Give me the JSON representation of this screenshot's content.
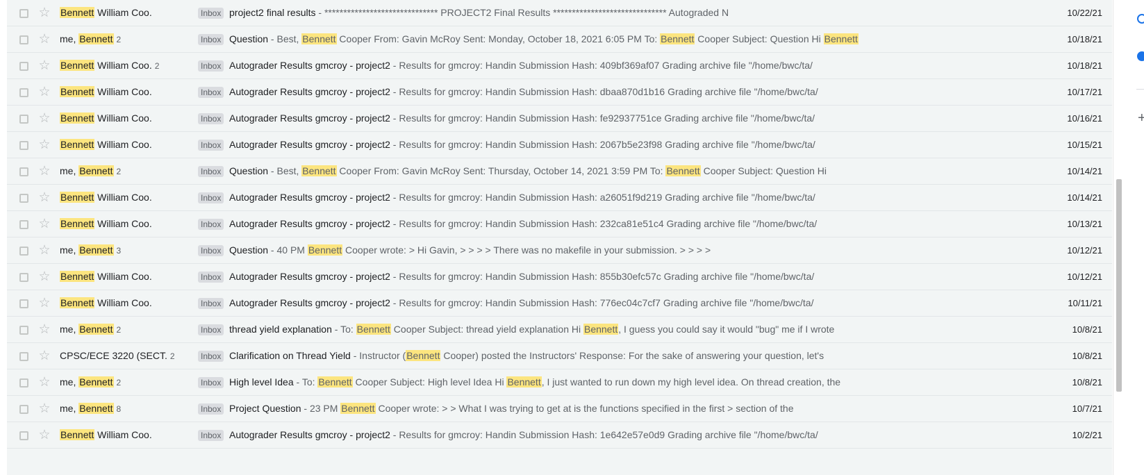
{
  "mail": {
    "label": "Inbox",
    "rows": [
      {
        "sender": [
          {
            "t": "Bennett",
            "h": true
          },
          {
            "t": " William Coo.",
            "h": false
          }
        ],
        "count": "",
        "subject": "project2 final results",
        "snippet": [
          {
            "t": " - ****************************** PROJECT2 Final Results ****************************** Autograded N",
            "h": false
          }
        ],
        "date": "10/22/21"
      },
      {
        "sender": [
          {
            "t": "me, ",
            "h": false
          },
          {
            "t": "Bennett",
            "h": true
          }
        ],
        "count": "2",
        "subject": "Question",
        "snippet": [
          {
            "t": " - Best, ",
            "h": false
          },
          {
            "t": "Bennett",
            "h": true
          },
          {
            "t": " Cooper From: Gavin McRoy Sent: Monday, October 18, 2021 6:05 PM To: ",
            "h": false
          },
          {
            "t": "Bennett",
            "h": true
          },
          {
            "t": " Cooper Subject: Question Hi ",
            "h": false
          },
          {
            "t": "Bennett",
            "h": true
          }
        ],
        "date": "10/18/21"
      },
      {
        "sender": [
          {
            "t": "Bennett",
            "h": true
          },
          {
            "t": " William Coo.",
            "h": false
          }
        ],
        "count": "2",
        "subject": "Autograder Results gmcroy - project2",
        "snippet": [
          {
            "t": " - Results for gmcroy: Handin Submission Hash: 409bf369af07 Grading archive file \"/home/bwc/ta/",
            "h": false
          }
        ],
        "date": "10/18/21"
      },
      {
        "sender": [
          {
            "t": "Bennett",
            "h": true
          },
          {
            "t": " William Coo.",
            "h": false
          }
        ],
        "count": "",
        "subject": "Autograder Results gmcroy - project2",
        "snippet": [
          {
            "t": " - Results for gmcroy: Handin Submission Hash: dbaa870d1b16 Grading archive file \"/home/bwc/ta/",
            "h": false
          }
        ],
        "date": "10/17/21"
      },
      {
        "sender": [
          {
            "t": "Bennett",
            "h": true
          },
          {
            "t": " William Coo.",
            "h": false
          }
        ],
        "count": "",
        "subject": "Autograder Results gmcroy - project2",
        "snippet": [
          {
            "t": " - Results for gmcroy: Handin Submission Hash: fe92937751ce Grading archive file \"/home/bwc/ta/",
            "h": false
          }
        ],
        "date": "10/16/21"
      },
      {
        "sender": [
          {
            "t": "Bennett",
            "h": true
          },
          {
            "t": " William Coo.",
            "h": false
          }
        ],
        "count": "",
        "subject": "Autograder Results gmcroy - project2",
        "snippet": [
          {
            "t": " - Results for gmcroy: Handin Submission Hash: 2067b5e23f98 Grading archive file \"/home/bwc/ta/",
            "h": false
          }
        ],
        "date": "10/15/21"
      },
      {
        "sender": [
          {
            "t": "me, ",
            "h": false
          },
          {
            "t": "Bennett",
            "h": true
          }
        ],
        "count": "2",
        "subject": "Question",
        "snippet": [
          {
            "t": " - Best, ",
            "h": false
          },
          {
            "t": "Bennett",
            "h": true
          },
          {
            "t": " Cooper From: Gavin McRoy Sent: Thursday, October 14, 2021 3:59 PM To: ",
            "h": false
          },
          {
            "t": "Bennett",
            "h": true
          },
          {
            "t": " Cooper Subject: Question Hi",
            "h": false
          }
        ],
        "date": "10/14/21"
      },
      {
        "sender": [
          {
            "t": "Bennett",
            "h": true
          },
          {
            "t": " William Coo.",
            "h": false
          }
        ],
        "count": "",
        "subject": "Autograder Results gmcroy - project2",
        "snippet": [
          {
            "t": " - Results for gmcroy: Handin Submission Hash: a26051f9d219 Grading archive file \"/home/bwc/ta/",
            "h": false
          }
        ],
        "date": "10/14/21"
      },
      {
        "sender": [
          {
            "t": "Bennett",
            "h": true
          },
          {
            "t": " William Coo.",
            "h": false
          }
        ],
        "count": "",
        "subject": "Autograder Results gmcroy - project2",
        "snippet": [
          {
            "t": " - Results for gmcroy: Handin Submission Hash: 232ca81e51c4 Grading archive file \"/home/bwc/ta/",
            "h": false
          }
        ],
        "date": "10/13/21"
      },
      {
        "sender": [
          {
            "t": "me, ",
            "h": false
          },
          {
            "t": "Bennett",
            "h": true
          }
        ],
        "count": "3",
        "subject": "Question",
        "snippet": [
          {
            "t": " - 40 PM ",
            "h": false
          },
          {
            "t": "Bennett",
            "h": true
          },
          {
            "t": " Cooper wrote: > Hi Gavin, > > > > There was no makefile in your submission. > > > >",
            "h": false
          }
        ],
        "date": "10/12/21"
      },
      {
        "sender": [
          {
            "t": "Bennett",
            "h": true
          },
          {
            "t": " William Coo.",
            "h": false
          }
        ],
        "count": "",
        "subject": "Autograder Results gmcroy - project2",
        "snippet": [
          {
            "t": " - Results for gmcroy: Handin Submission Hash: 855b30efc57c Grading archive file \"/home/bwc/ta/",
            "h": false
          }
        ],
        "date": "10/12/21"
      },
      {
        "sender": [
          {
            "t": "Bennett",
            "h": true
          },
          {
            "t": " William Coo.",
            "h": false
          }
        ],
        "count": "",
        "subject": "Autograder Results gmcroy - project2",
        "snippet": [
          {
            "t": " - Results for gmcroy: Handin Submission Hash: 776ec04c7cf7 Grading archive file \"/home/bwc/ta/",
            "h": false
          }
        ],
        "date": "10/11/21"
      },
      {
        "sender": [
          {
            "t": "me, ",
            "h": false
          },
          {
            "t": "Bennett",
            "h": true
          }
        ],
        "count": "2",
        "subject": "thread yield explanation",
        "snippet": [
          {
            "t": " - To: ",
            "h": false
          },
          {
            "t": "Bennett",
            "h": true
          },
          {
            "t": " Cooper Subject: thread yield explanation Hi ",
            "h": false
          },
          {
            "t": "Bennett",
            "h": true
          },
          {
            "t": ", I guess you could say it would \"bug\" me if I wrote",
            "h": false
          }
        ],
        "date": "10/8/21"
      },
      {
        "sender": [
          {
            "t": "CPSC/ECE 3220 (SECT.",
            "h": false
          }
        ],
        "count": "2",
        "subject": "Clarification on Thread Yield",
        "snippet": [
          {
            "t": " - Instructor (",
            "h": false
          },
          {
            "t": "Bennett",
            "h": true
          },
          {
            "t": " Cooper) posted the Instructors' Response: For the sake of answering your question, let's",
            "h": false
          }
        ],
        "date": "10/8/21"
      },
      {
        "sender": [
          {
            "t": "me, ",
            "h": false
          },
          {
            "t": "Bennett",
            "h": true
          }
        ],
        "count": "2",
        "subject": "High level Idea",
        "snippet": [
          {
            "t": " - To: ",
            "h": false
          },
          {
            "t": "Bennett",
            "h": true
          },
          {
            "t": " Cooper Subject: High level Idea Hi ",
            "h": false
          },
          {
            "t": "Bennett",
            "h": true
          },
          {
            "t": ", I just wanted to run down my high level idea. On thread creation, the",
            "h": false
          }
        ],
        "date": "10/8/21"
      },
      {
        "sender": [
          {
            "t": "me, ",
            "h": false
          },
          {
            "t": "Bennett",
            "h": true
          }
        ],
        "count": "8",
        "subject": "Project Question",
        "snippet": [
          {
            "t": " - 23 PM ",
            "h": false
          },
          {
            "t": "Bennett",
            "h": true
          },
          {
            "t": " Cooper wrote: > > What I was trying to get at is the functions specified in the first > section of the",
            "h": false
          }
        ],
        "date": "10/7/21"
      },
      {
        "sender": [
          {
            "t": "Bennett",
            "h": true
          },
          {
            "t": " William Coo.",
            "h": false
          }
        ],
        "count": "",
        "subject": "Autograder Results gmcroy - project2",
        "snippet": [
          {
            "t": " - Results for gmcroy: Handin Submission Hash: 1e642e57e0d9 Grading archive file \"/home/bwc/ta/",
            "h": false
          }
        ],
        "date": "10/2/21"
      }
    ]
  },
  "sidepanel": {
    "icons": [
      "calendar-icon",
      "contacts-icon",
      "add-icon"
    ],
    "add_glyph": "+"
  }
}
